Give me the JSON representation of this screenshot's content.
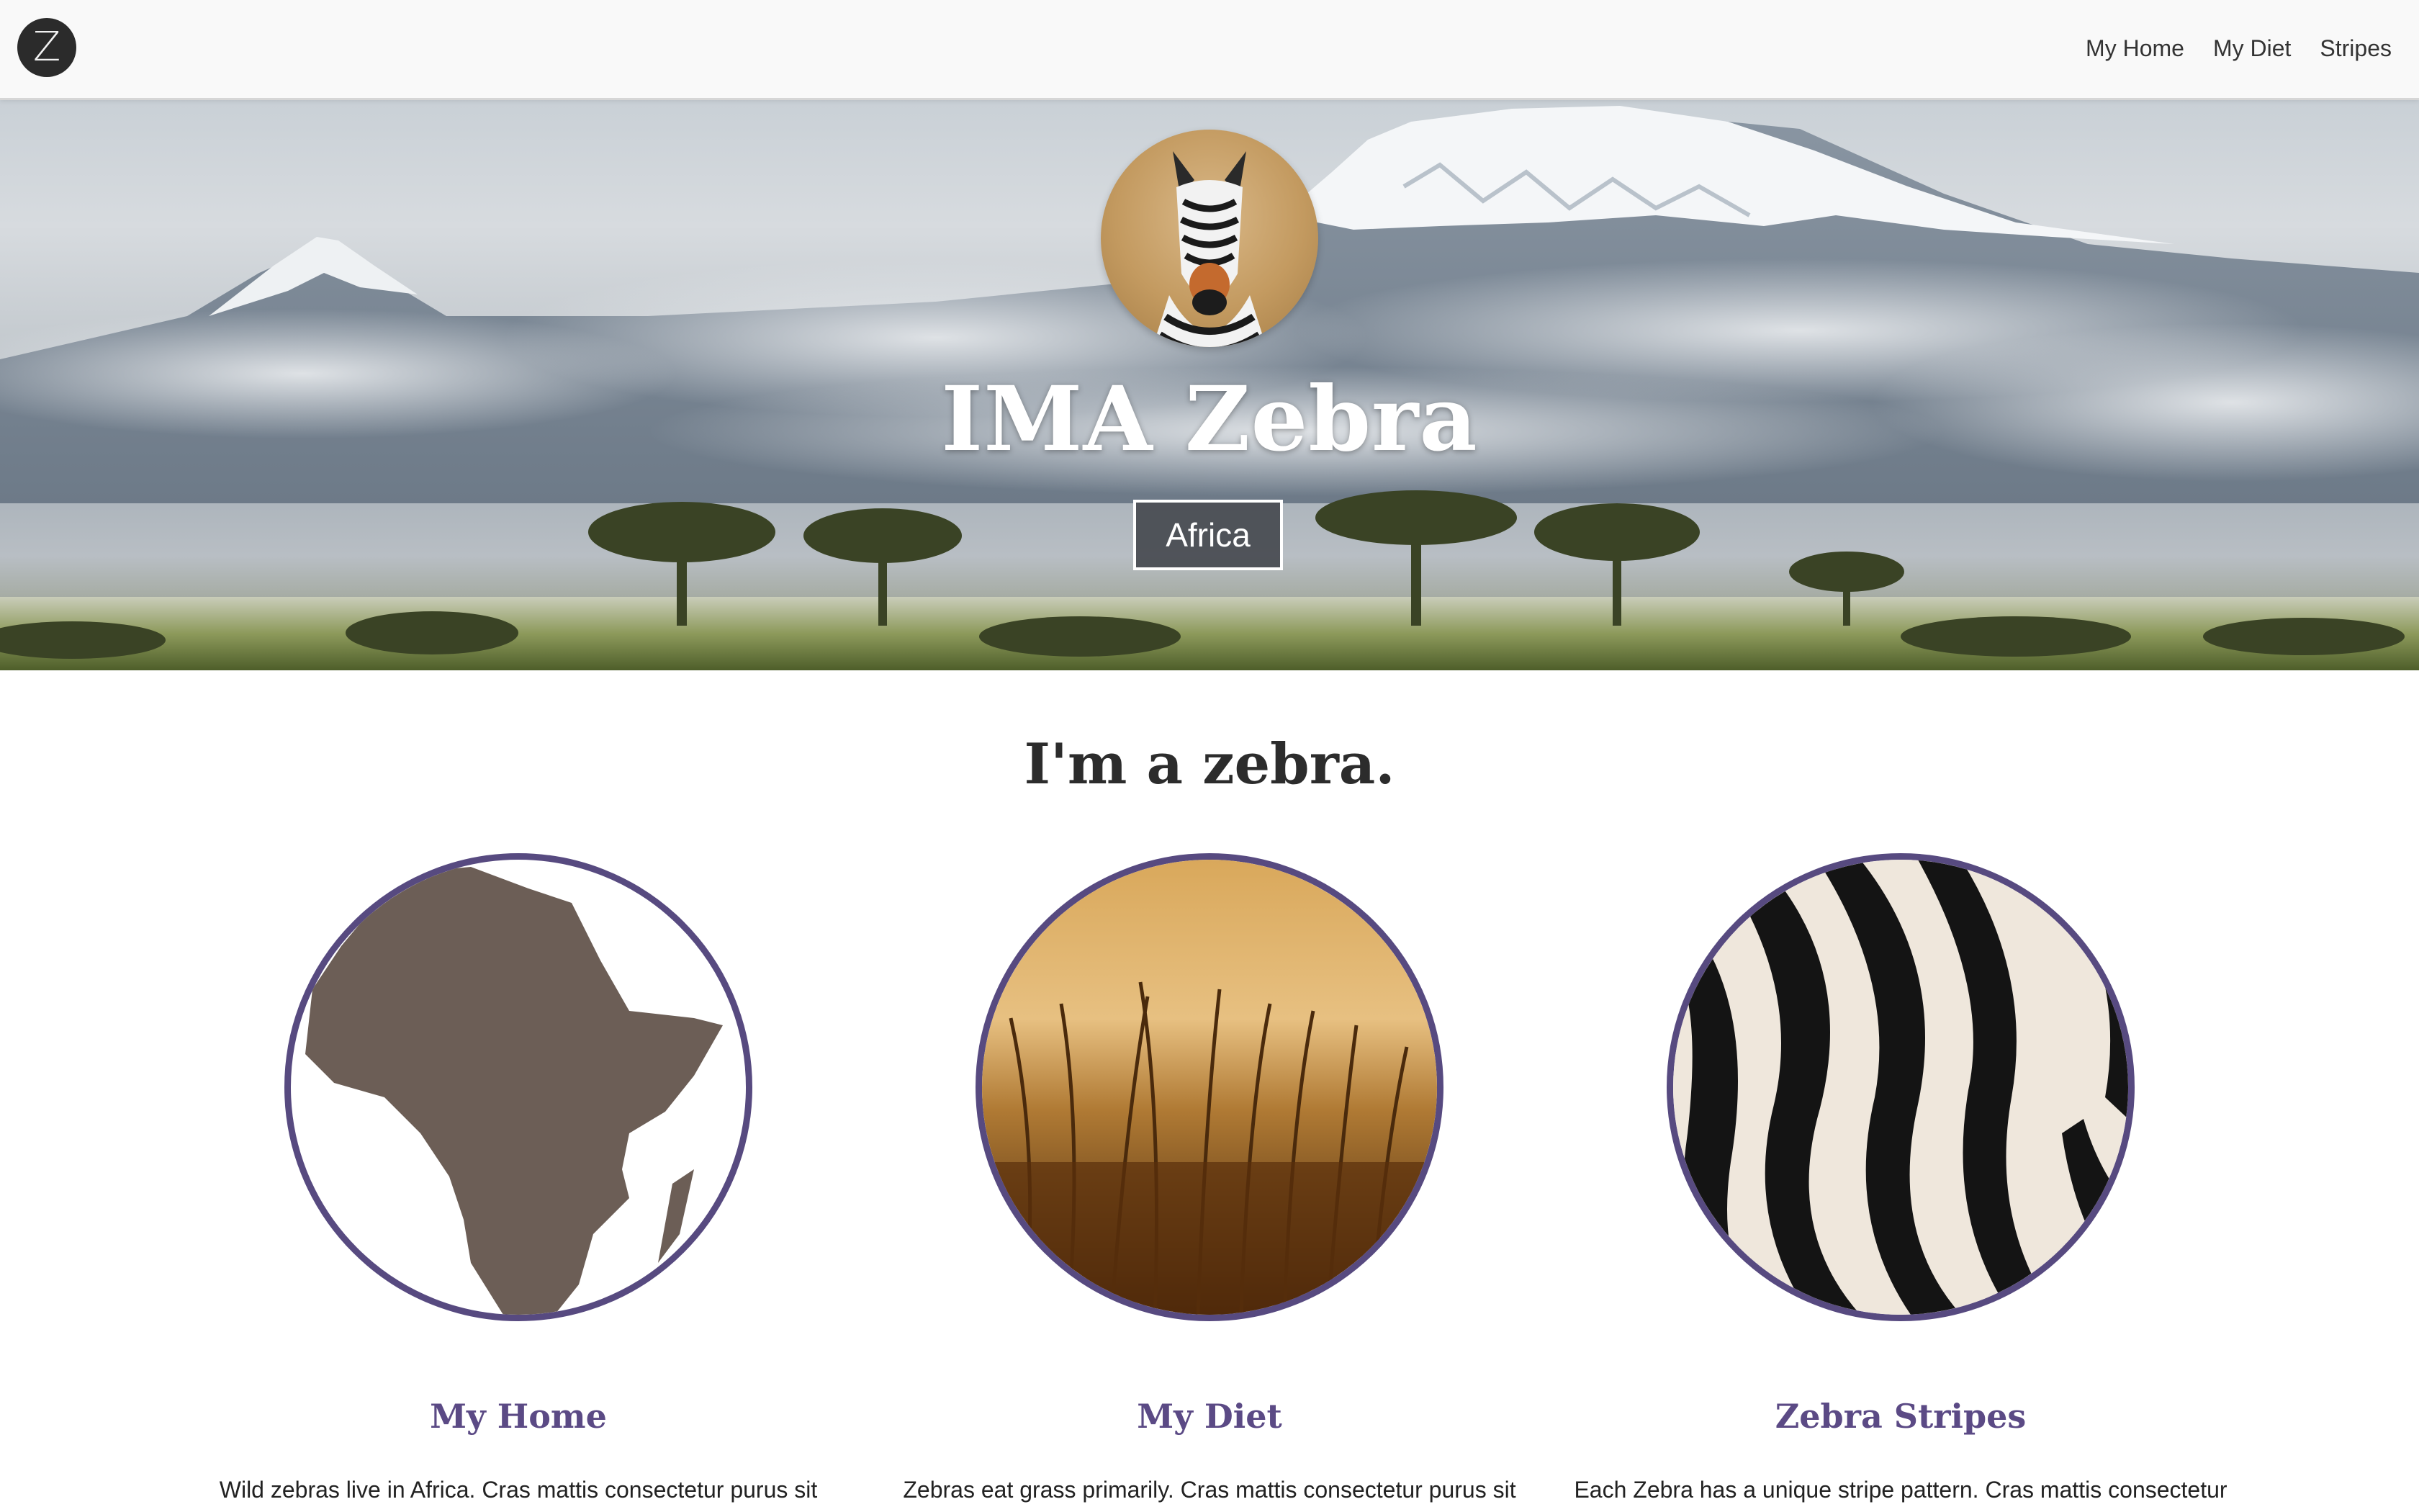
{
  "navbar": {
    "logo_letter": "Z",
    "links": [
      {
        "label": "My Home"
      },
      {
        "label": "My Diet"
      },
      {
        "label": "Stripes"
      }
    ]
  },
  "hero": {
    "title": "IMA Zebra",
    "button_label": "Africa"
  },
  "main": {
    "heading": "I'm a zebra.",
    "cards": [
      {
        "title": "My Home",
        "text": "Wild zebras live in Africa. Cras mattis consectetur purus sit",
        "image": "africa-map"
      },
      {
        "title": "My Diet",
        "text": "Zebras eat grass primarily. Cras mattis consectetur purus sit",
        "image": "savanna-grass"
      },
      {
        "title": "Zebra Stripes",
        "text": "Each Zebra has a unique stripe pattern. Cras mattis consectetur",
        "image": "zebra-stripes"
      }
    ]
  },
  "colors": {
    "accent": "#574a80",
    "heading_purple": "#5b4a85",
    "africa_fill": "#6c5e56",
    "navbar_bg": "#f9f9f9"
  }
}
